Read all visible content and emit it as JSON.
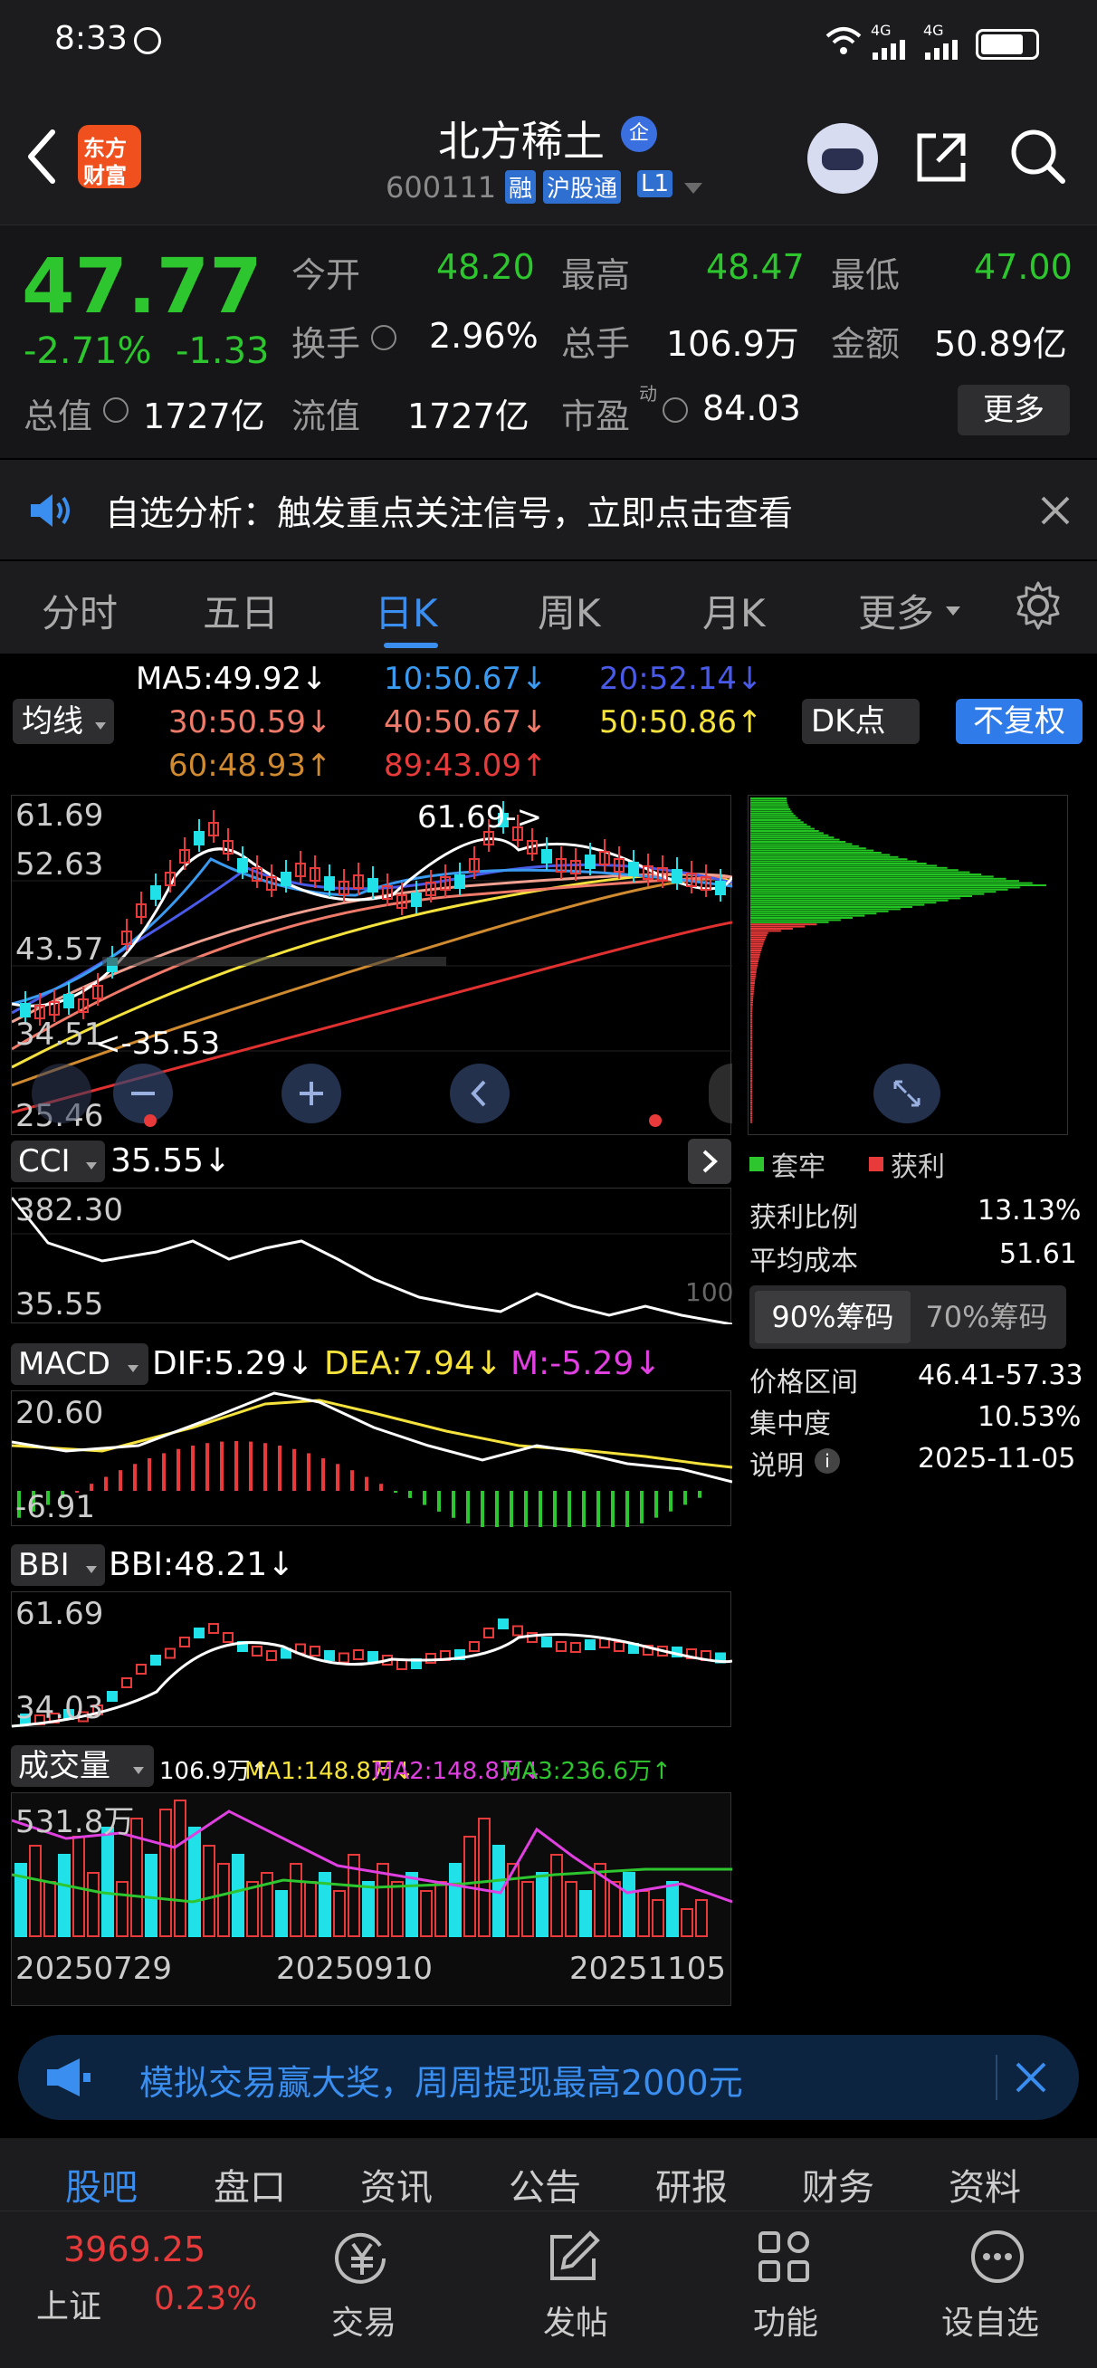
{
  "status_bar": {
    "time": "8:33",
    "signal1": "4G",
    "signal2": "4G"
  },
  "header": {
    "app_logo_line1": "东方",
    "app_logo_line2": "财富",
    "stock_name": "北方稀土",
    "enterprise_badge": "企",
    "stock_code": "600111",
    "tag_margin": "融",
    "tag_connect": "沪股通",
    "tag_level": "L1"
  },
  "quote": {
    "price": "47.77",
    "change_pct": "-2.71%",
    "change_abs": "-1.33",
    "open_label": "今开",
    "open": "48.20",
    "high_label": "最高",
    "high": "48.47",
    "low_label": "最低",
    "low": "47.00",
    "turnover_label": "换手",
    "turnover": "2.96%",
    "volume_label": "总手",
    "volume": "106.9万",
    "amount_label": "金额",
    "amount": "50.89亿",
    "mktcap_label": "总值",
    "mktcap": "1727亿",
    "float_label": "流值",
    "float": "1727亿",
    "pe_label": "市盈",
    "pe_sup": "动",
    "pe": "84.03",
    "more_button": "更多"
  },
  "notice": {
    "text": "自选分析：触发重点关注信号，立即点击查看"
  },
  "period_tabs": [
    "分时",
    "五日",
    "日K",
    "周K",
    "月K",
    "更多"
  ],
  "active_tab": "日K",
  "ma": {
    "selector": "均线",
    "dk_button": "DK点",
    "adjust_button": "不复权",
    "ma5": "MA5:49.92↓",
    "ma10": "10:50.67↓",
    "ma20": "20:52.14↓",
    "ma30": "30:50.59↓",
    "ma40": "40:50.67↓",
    "ma50": "50:50.86↑",
    "ma60": "60:48.93↑",
    "ma89": "89:43.09↑"
  },
  "kline": {
    "y_top": "61.69",
    "y_2": "52.63",
    "y_3": "43.57",
    "y_4": "34.51",
    "y_bottom": "25.46",
    "max_annot": "61.69->",
    "min_annot": "<-35.53"
  },
  "cci": {
    "selector": "CCI",
    "value": "35.55↓",
    "y_top": "382.30",
    "y_bottom": "35.55",
    "ref": "100"
  },
  "macd": {
    "selector": "MACD",
    "dif": "DIF:5.29↓",
    "dea": "DEA:7.94↓",
    "m": "M:-5.29↓",
    "y_top": "20.60",
    "y_bottom": "-6.91"
  },
  "bbi": {
    "selector": "BBI",
    "value": "BBI:48.21↓",
    "y_top": "61.69",
    "y_bottom": "34.03"
  },
  "volume_panel": {
    "selector": "成交量",
    "vol": "106.9万↑",
    "ma1": "MA1:148.8万↓",
    "ma2": "MA2:148.8万↓",
    "ma3": "MA3:236.6万↑",
    "y_top": "531.8万"
  },
  "dates": [
    "20250729",
    "20250910",
    "20251105"
  ],
  "chips": {
    "legend_trapped": "套牢",
    "legend_profit": "获利",
    "rows": [
      {
        "label": "获利比例",
        "value": "13.13%"
      },
      {
        "label": "平均成本",
        "value": "51.61"
      }
    ],
    "tab_90": "90%筹码",
    "tab_70": "70%筹码",
    "rows2": [
      {
        "label": "价格区间",
        "value": "46.41-57.33"
      },
      {
        "label": "集中度",
        "value": "10.53%"
      },
      {
        "label": "说明",
        "value": "2025-11-05"
      }
    ]
  },
  "promo": {
    "text": "模拟交易赢大奖，周周提现最高2000元"
  },
  "content_tabs": [
    "股吧",
    "盘口",
    "资讯",
    "公告",
    "研报",
    "财务",
    "资料"
  ],
  "index": {
    "value": "3969.25",
    "name": "上证",
    "change": "0.23%"
  },
  "bottom_nav": [
    "交易",
    "发帖",
    "功能",
    "设自选"
  ],
  "colors": {
    "up": "#e83a3a",
    "down": "#2ec62e",
    "accent": "#2f7bea",
    "cyan": "#20e0e8",
    "yellow": "#f5e23c",
    "magenta": "#e040e0"
  }
}
